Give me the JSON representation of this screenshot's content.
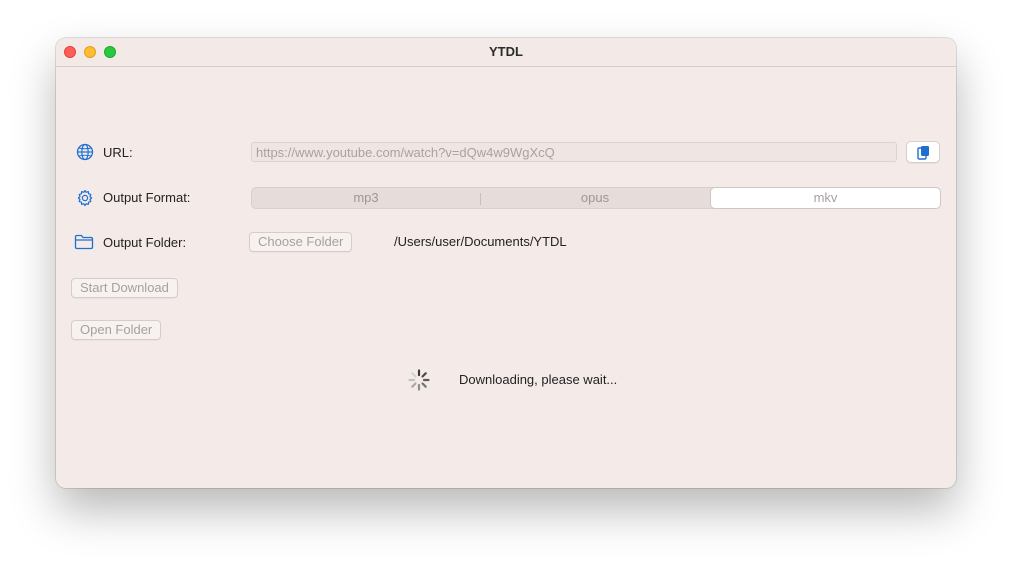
{
  "window": {
    "title": "YTDL"
  },
  "url": {
    "label": "URL:",
    "placeholder": "https://www.youtube.com/watch?v=dQw4w9WgXcQ",
    "value": ""
  },
  "output_format": {
    "label": "Output Format:",
    "options": [
      "mp3",
      "opus",
      "mkv"
    ],
    "selected": "mkv"
  },
  "output_folder": {
    "label": "Output Folder:",
    "choose_button": "Choose Folder",
    "path": "/Users/user/Documents/YTDL"
  },
  "actions": {
    "start_download": "Start Download",
    "open_folder": "Open Folder"
  },
  "status": {
    "message": "Downloading, please wait..."
  },
  "colors": {
    "accent": "#1f6fd1",
    "window_bg": "#f4ebe8",
    "close": "#ff5f57",
    "minimize": "#febc2e",
    "maximize": "#28c840"
  },
  "icons": {
    "url": "globe-icon",
    "format": "gear-icon",
    "folder": "folder-icon",
    "paste": "clipboard-icon",
    "progress": "spinner-icon"
  }
}
